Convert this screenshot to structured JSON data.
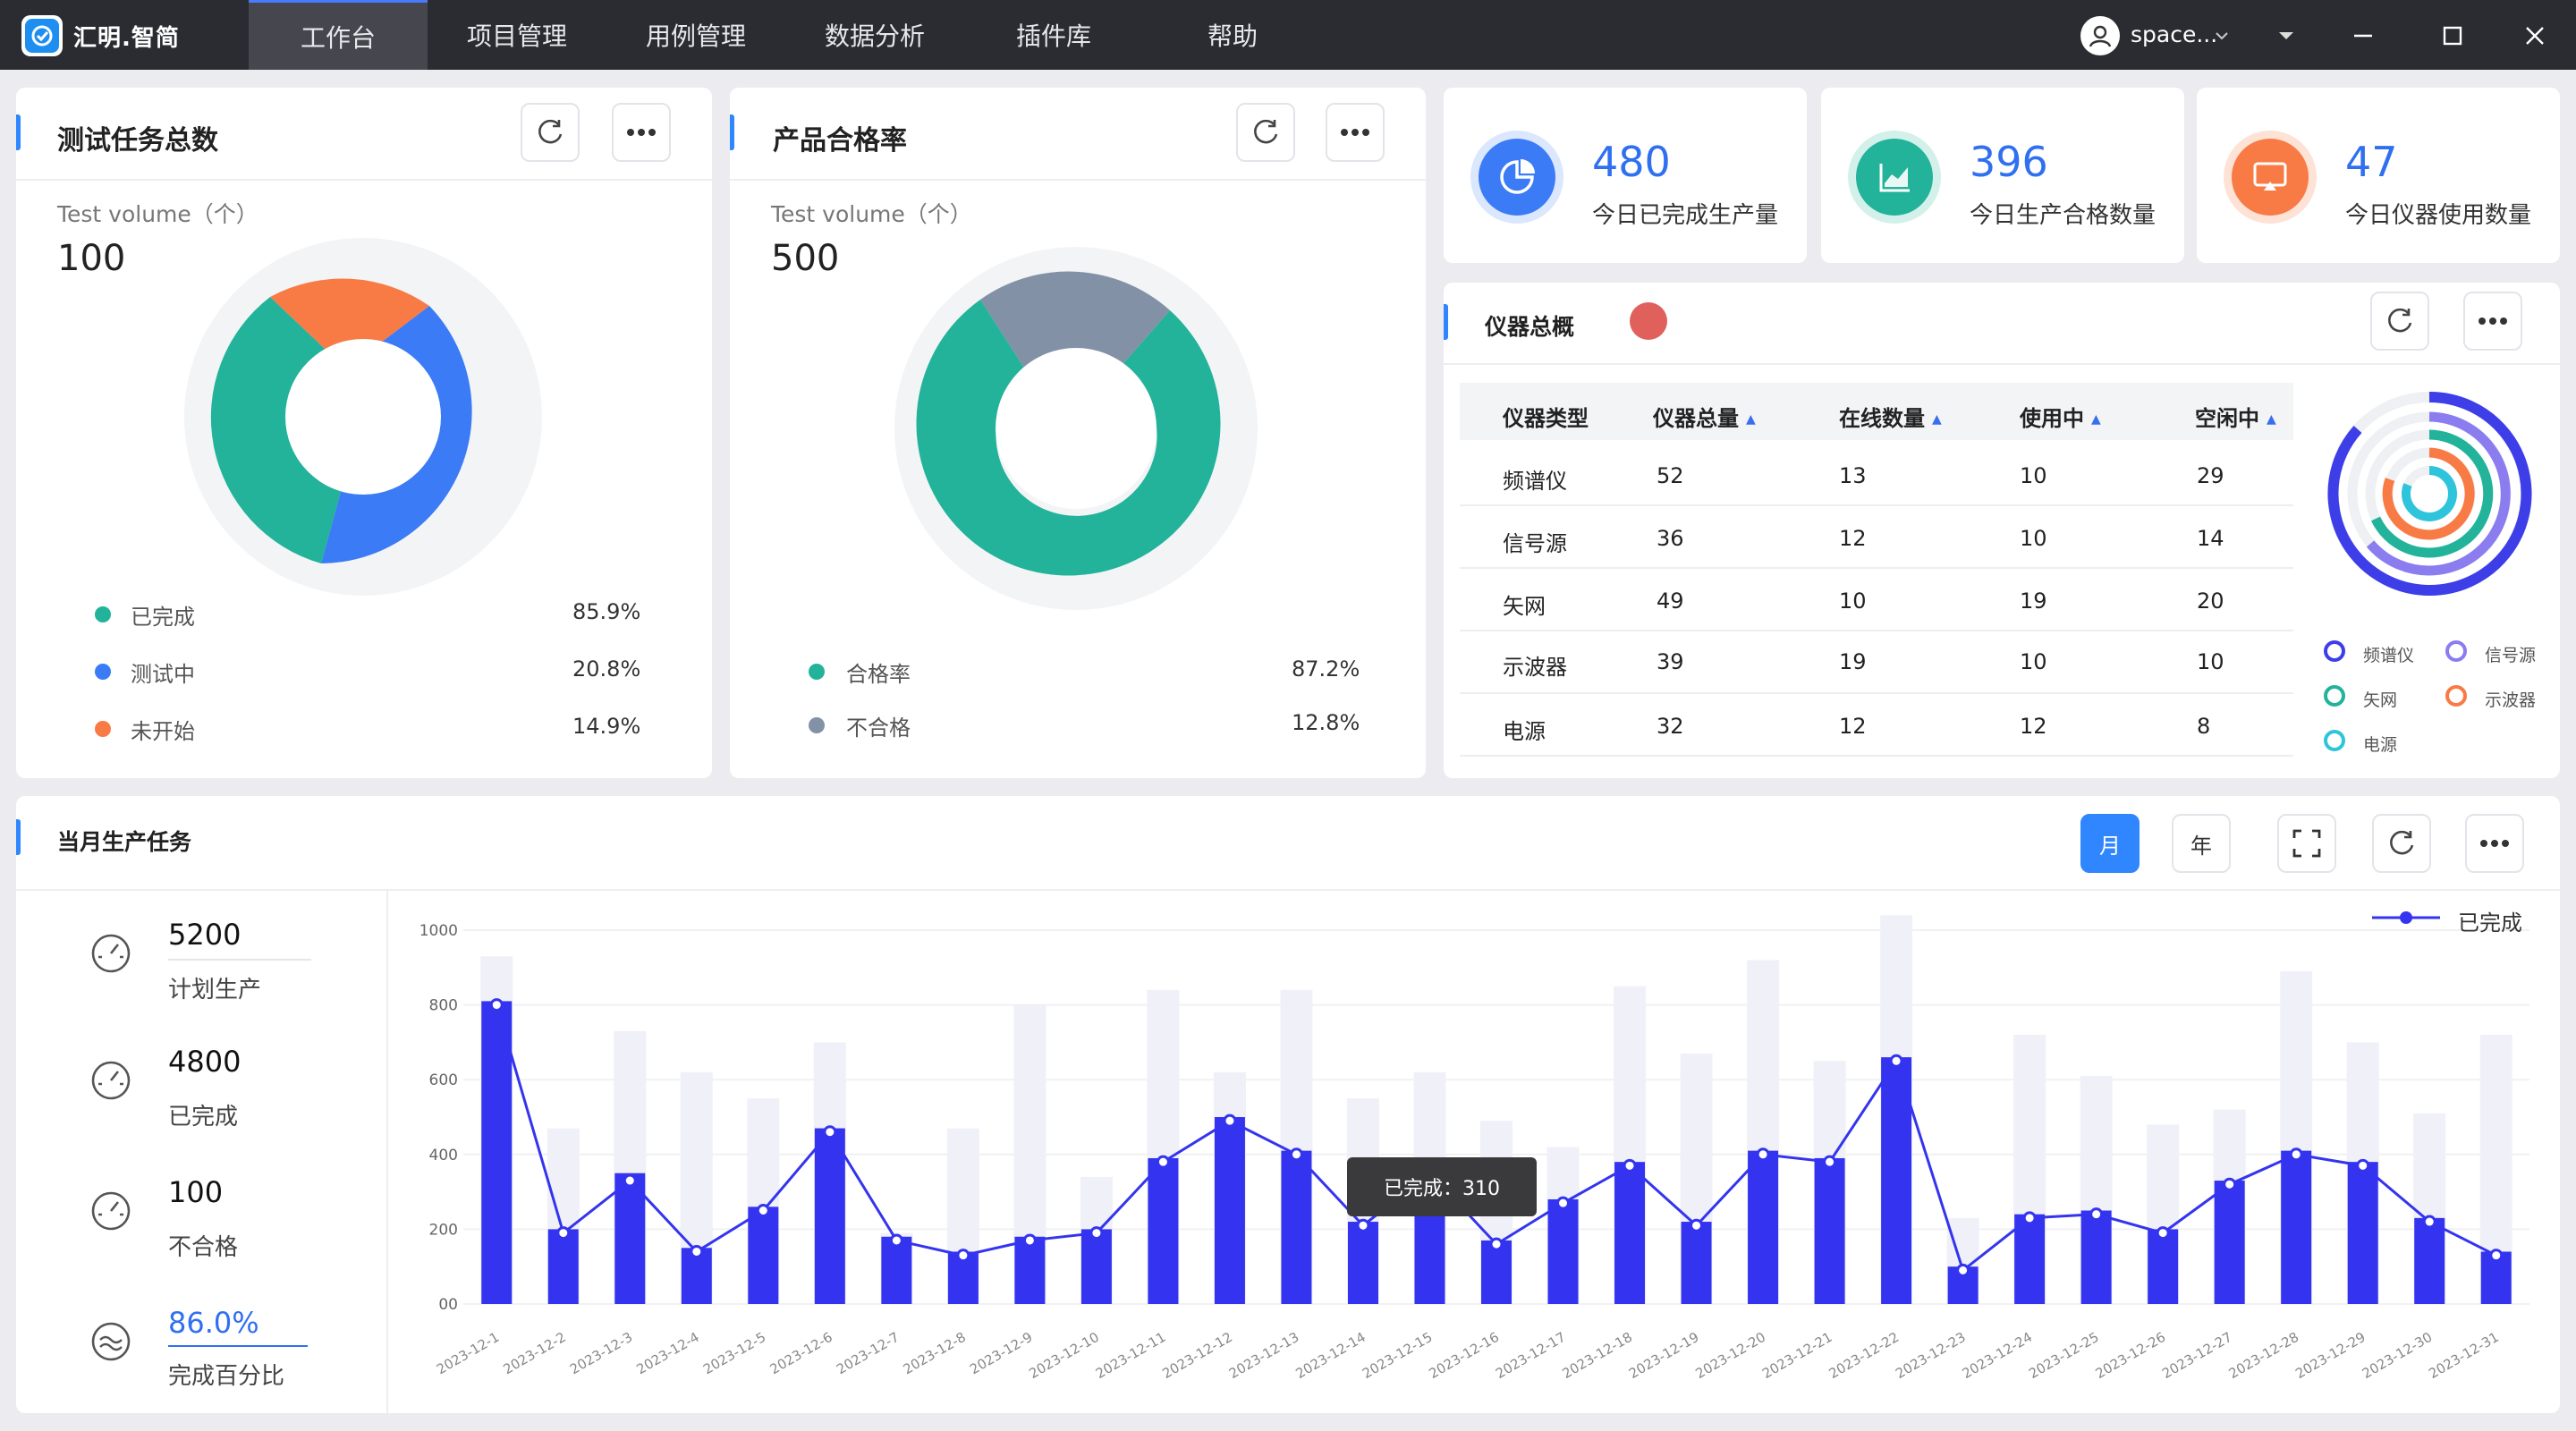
{
  "app": {
    "brand": "汇明.智简",
    "nav": [
      "工作台",
      "项目管理",
      "用例管理",
      "数据分析",
      "插件库",
      "帮助"
    ],
    "active_nav": 0,
    "user_name": "space..."
  },
  "task_total": {
    "title": "测试任务总数",
    "unit_label": "Test volume（个）",
    "total": "100",
    "legend": [
      {
        "label": "已完成",
        "value": "85.9%",
        "color": "#22b39a"
      },
      {
        "label": "测试中",
        "value": "20.8%",
        "color": "#3b7bf6"
      },
      {
        "label": "未开始",
        "value": "14.9%",
        "color": "#f87b45"
      }
    ]
  },
  "pass_rate": {
    "title": "产品合格率",
    "unit_label": "Test volume（个）",
    "total": "500",
    "legend": [
      {
        "label": "合格率",
        "value": "87.2%",
        "color": "#22b39a"
      },
      {
        "label": "不合格",
        "value": "12.8%",
        "color": "#8391a7"
      }
    ]
  },
  "stats": [
    {
      "value": "480",
      "label": "今日已完成生产量",
      "color": "#3b7bf6",
      "bg": "#dbe7fd",
      "icon": "pie-chart-icon"
    },
    {
      "value": "396",
      "label": "今日生产合格数量",
      "color": "#22b39a",
      "bg": "#d3f1ea",
      "icon": "area-chart-icon"
    },
    {
      "value": "47",
      "label": "今日仪器使用数量",
      "color": "#f87b45",
      "bg": "#fde2d5",
      "icon": "monitor-icon"
    }
  ],
  "instruments": {
    "title": "仪器总概",
    "status_color": "#e0605c",
    "columns": [
      "仪器类型",
      "仪器总量",
      "在线数量",
      "使用中",
      "空闲中"
    ],
    "rows": [
      [
        "频谱仪",
        "52",
        "13",
        "10",
        "29"
      ],
      [
        "信号源",
        "36",
        "12",
        "10",
        "14"
      ],
      [
        "矢网",
        "49",
        "10",
        "19",
        "20"
      ],
      [
        "示波器",
        "39",
        "19",
        "10",
        "10"
      ],
      [
        "电源",
        "32",
        "12",
        "12",
        "8"
      ]
    ],
    "legend": [
      {
        "label": "频谱仪",
        "color": "#3d3ee8"
      },
      {
        "label": "信号源",
        "color": "#8b7cf0"
      },
      {
        "label": "矢网",
        "color": "#22b39a"
      },
      {
        "label": "示波器",
        "color": "#f87b45"
      },
      {
        "label": "电源",
        "color": "#2ec4dc"
      }
    ]
  },
  "monthly": {
    "title": "当月生产任务",
    "toggle": [
      "月",
      "年"
    ],
    "kpis": [
      {
        "value": "5200",
        "label": "计划生产"
      },
      {
        "value": "4800",
        "label": "已完成"
      },
      {
        "value": "100",
        "label": "不合格"
      },
      {
        "value": "86.0%",
        "label": "完成百分比"
      }
    ],
    "tooltip": "已完成：310"
  },
  "chart_data": {
    "type": "bar",
    "categories": [
      "2023-12-1",
      "2023-12-2",
      "2023-12-3",
      "2023-12-4",
      "2023-12-5",
      "2023-12-6",
      "2023-12-7",
      "2023-12-8",
      "2023-12-9",
      "2023-12-10",
      "2023-12-11",
      "2023-12-12",
      "2023-12-13",
      "2023-12-14",
      "2023-12-15",
      "2023-12-16",
      "2023-12-17",
      "2023-12-18",
      "2023-12-19",
      "2023-12-20",
      "2023-12-21",
      "2023-12-22",
      "2023-12-23",
      "2023-12-24",
      "2023-12-25",
      "2023-12-26",
      "2023-12-27",
      "2023-12-28",
      "2023-12-29",
      "2023-12-30",
      "2023-12-31"
    ],
    "y_ticks": [
      "1000",
      "800",
      "600",
      "400",
      "200",
      "00"
    ],
    "ylim": [
      0,
      1000
    ],
    "series": [
      {
        "name": "",
        "kind": "bar-background",
        "color": "#f0f0f8",
        "values": [
          930,
          470,
          730,
          620,
          550,
          700,
          190,
          470,
          800,
          340,
          840,
          620,
          840,
          550,
          620,
          490,
          420,
          850,
          670,
          920,
          650,
          1040,
          230,
          720,
          610,
          480,
          520,
          890,
          700,
          510,
          720
        ]
      },
      {
        "name": "",
        "kind": "bar",
        "color": "#3434f0",
        "values": [
          810,
          200,
          350,
          150,
          260,
          470,
          180,
          140,
          180,
          200,
          390,
          500,
          410,
          220,
          360,
          170,
          280,
          380,
          220,
          410,
          390,
          660,
          100,
          240,
          250,
          200,
          330,
          410,
          380,
          230,
          140
        ]
      },
      {
        "name": "已完成",
        "kind": "line",
        "color": "#3434f0",
        "values": [
          800,
          190,
          330,
          140,
          250,
          460,
          170,
          130,
          170,
          190,
          380,
          490,
          400,
          210,
          350,
          160,
          270,
          370,
          210,
          400,
          380,
          650,
          90,
          230,
          240,
          190,
          320,
          400,
          370,
          220,
          130
        ]
      }
    ],
    "legend": "top-right",
    "grid": true,
    "highlight_index": 13
  }
}
